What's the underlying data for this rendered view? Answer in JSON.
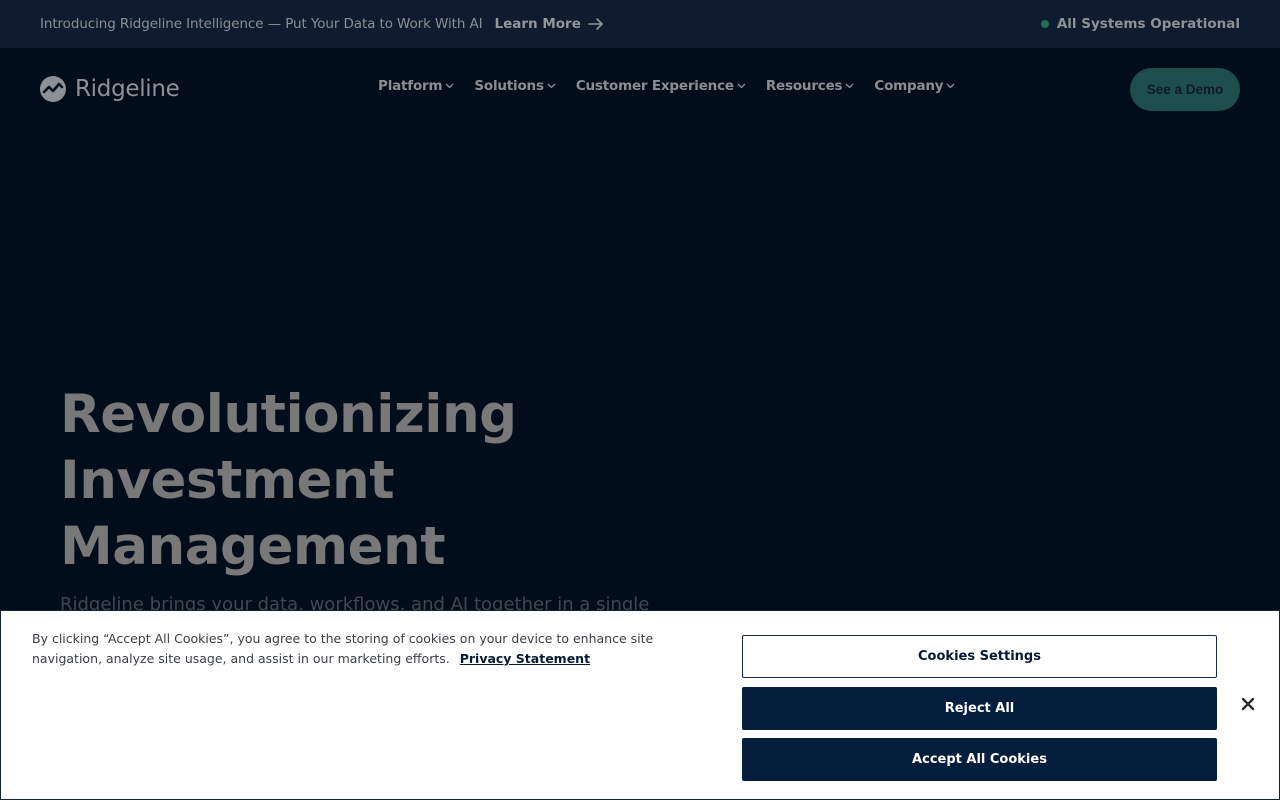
{
  "announcement": {
    "text": "Introducing Ridgeline Intelligence — Put Your Data to Work With AI",
    "link_label": "Learn More",
    "arrow_icon": "arrow-right-icon",
    "status_label": "All Systems Operational",
    "status_color": "#256b55"
  },
  "nav": {
    "logo_text": "Ridgeline",
    "menu": [
      {
        "label": "Platform"
      },
      {
        "label": "Solutions"
      },
      {
        "label": "Customer Experience"
      },
      {
        "label": "Resources"
      },
      {
        "label": "Company"
      }
    ],
    "cta_label": "See a Demo"
  },
  "hero": {
    "title_lines": [
      "Revolutionizing",
      "Investment",
      "Management"
    ],
    "subtitle": "Ridgeline brings your data, workflows, and AI together in a single"
  },
  "cookie": {
    "text": "By clicking “Accept All Cookies”, you agree to the storing of cookies on your device to enhance site navigation, analyze site usage, and assist in our marketing efforts.",
    "privacy_link": "Privacy Statement",
    "settings_label": "Cookies Settings",
    "reject_label": "Reject All",
    "accept_label": "Accept All Cookies",
    "close_icon": "close-icon"
  },
  "colors": {
    "page_bg": "#010d1a",
    "banner_bg": "#0f1b2e",
    "cta_bg": "#1e4e4c",
    "cookie_button_bg": "#061e3d"
  }
}
